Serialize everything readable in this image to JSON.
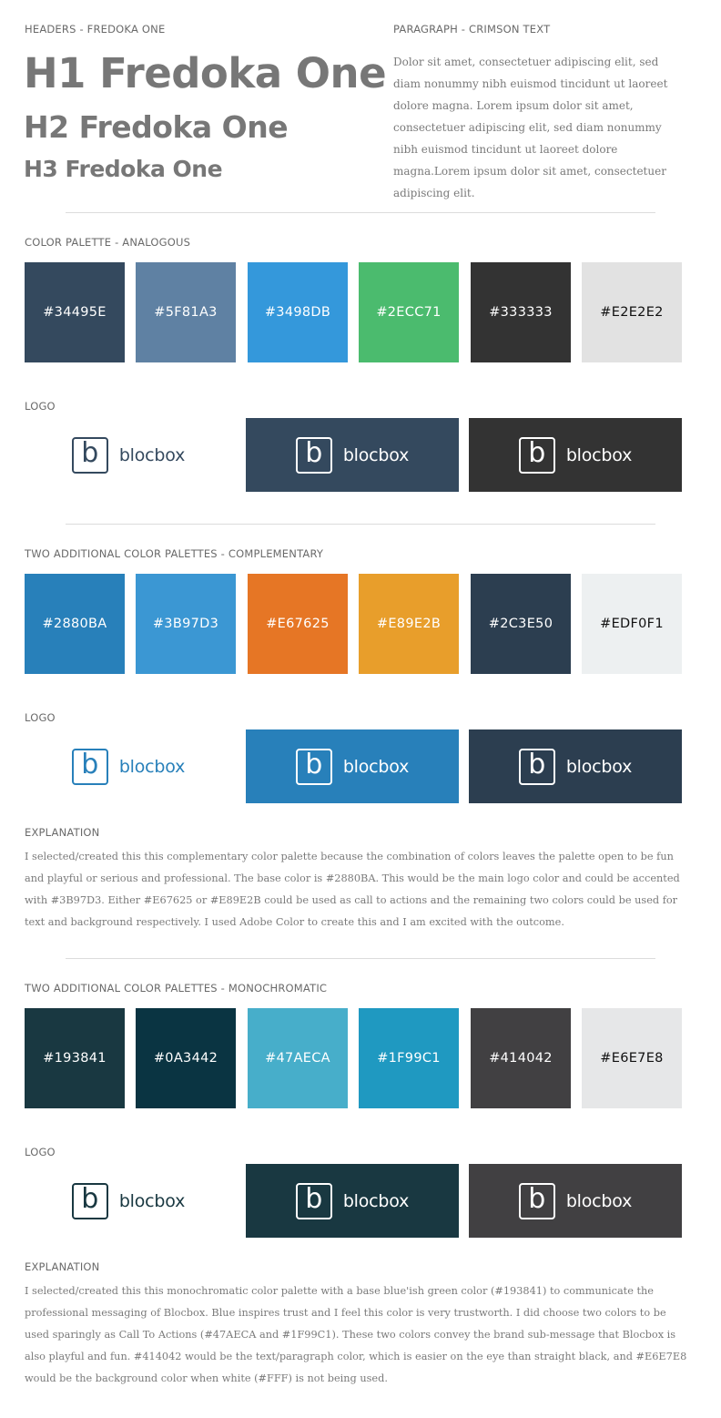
{
  "headers": {
    "label": "HEADERS - FREDOKA ONE",
    "h1": "H1 Fredoka One",
    "h2": "H2 Fredoka One",
    "h3": "H3 Fredoka One"
  },
  "paragraph": {
    "label": "PARAGRAPH - CRIMSON TEXT",
    "text": "Dolor sit amet, consectetuer adipiscing elit, sed diam nonummy nibh euismod tincidunt ut laoreet dolore magna. Lorem ipsum dolor sit amet, consectetuer adipiscing elit, sed diam nonummy nibh euismod tincidunt ut laoreet dolore magna.Lorem ipsum dolor sit amet, consectetuer adipiscing elit."
  },
  "analogous": {
    "label": "COLOR PALETTE - ANALOGOUS",
    "swatches": [
      {
        "hex": "#34495E",
        "color": "#34495E"
      },
      {
        "hex": "#5F81A3",
        "color": "#5F81A3"
      },
      {
        "hex": "#3498DB",
        "color": "#3498DB"
      },
      {
        "hex": "#2ECC71",
        "color": "#4BBB6E"
      },
      {
        "hex": "#333333",
        "color": "#333333"
      },
      {
        "hex": "#E2E2E2",
        "color": "#E2E2E2"
      }
    ],
    "logo_label": "LOGO",
    "logo_word": "blocbox",
    "logo_letter": "b",
    "logos": [
      {
        "bg": "#FFFFFF",
        "fg": "#34495E"
      },
      {
        "bg": "#34495E",
        "fg": "#FFFFFF"
      },
      {
        "bg": "#333333",
        "fg": "#FFFFFF"
      }
    ]
  },
  "complementary": {
    "label": "TWO ADDITIONAL COLOR PALETTES - COMPLEMENTARY",
    "swatches": [
      {
        "hex": "#2880BA",
        "color": "#2880BA"
      },
      {
        "hex": "#3B97D3",
        "color": "#3B97D3"
      },
      {
        "hex": "#E67625",
        "color": "#E67625"
      },
      {
        "hex": "#E89E2B",
        "color": "#E89E2B"
      },
      {
        "hex": "#2C3E50",
        "color": "#2C3E50"
      },
      {
        "hex": "#EDF0F1",
        "color": "#EDF0F1"
      }
    ],
    "logo_label": "LOGO",
    "logo_word": "blocbox",
    "logo_letter": "b",
    "logos": [
      {
        "bg": "#FFFFFF",
        "fg": "#2880BA"
      },
      {
        "bg": "#2880BA",
        "fg": "#FFFFFF"
      },
      {
        "bg": "#2C3E50",
        "fg": "#FFFFFF"
      }
    ],
    "explanation_label": "EXPLANATION",
    "explanation": "I selected/created this this complementary color palette because the combination of colors leaves the palette open to be fun and playful or serious and professional. The base color is #2880BA. This would be the main logo color and could be accented with #3B97D3. Either #E67625 or #E89E2B could be used as call to actions and the remaining two colors could be used for text and background respectively. I used Adobe Color to create this and I am excited with the outcome."
  },
  "monochromatic": {
    "label": "TWO ADDITIONAL COLOR PALETTES - MONOCHROMATIC",
    "swatches": [
      {
        "hex": "#193841",
        "color": "#193841"
      },
      {
        "hex": "#0A3442",
        "color": "#0A3442"
      },
      {
        "hex": "#47AECA",
        "color": "#47AECA"
      },
      {
        "hex": "#1F99C1",
        "color": "#1F99C1"
      },
      {
        "hex": "#414042",
        "color": "#414042"
      },
      {
        "hex": "#E6E7E8",
        "color": "#E6E7E8"
      }
    ],
    "logo_label": "LOGO",
    "logo_word": "blocbox",
    "logo_letter": "b",
    "logos": [
      {
        "bg": "#FFFFFF",
        "fg": "#193841"
      },
      {
        "bg": "#193841",
        "fg": "#FFFFFF"
      },
      {
        "bg": "#414042",
        "fg": "#FFFFFF"
      }
    ],
    "explanation_label": "EXPLANATION",
    "explanation": "I selected/created this this monochromatic color palette with a base blue'ish green color (#193841) to communicate the professional messaging of Blocbox. Blue inspires trust and I feel this color is very trustworth. I did choose two colors to be used sparingly as Call To Actions (#47AECA and #1F99C1). These two colors convey the brand sub-message that Blocbox is also playful and fun. #414042 would be the text/paragraph color, which is easier on the eye than straight black, and #E6E7E8 would be the background color when white (#FFF) is not being used."
  }
}
